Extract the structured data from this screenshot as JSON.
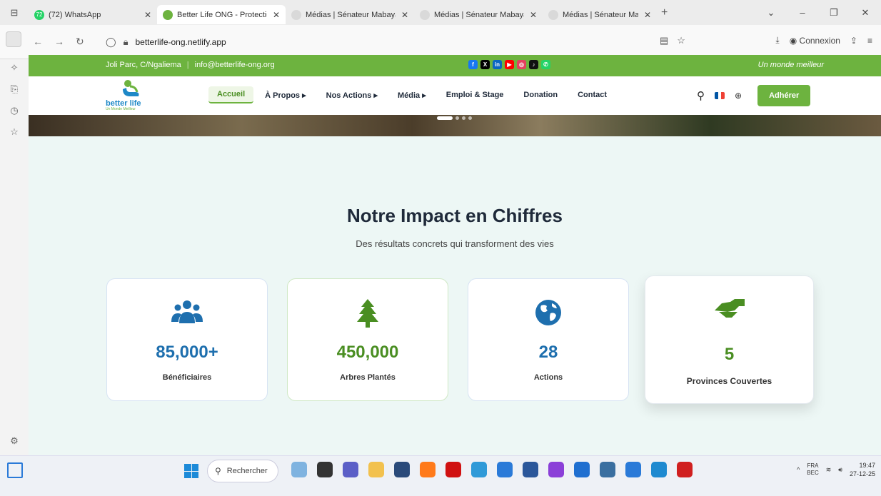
{
  "browser": {
    "tabs": [
      {
        "title": "(72) WhatsApp",
        "badge": "72",
        "color": "#25d366",
        "active": false
      },
      {
        "title": "Better Life ONG - Protection de",
        "color": "#6db33f",
        "active": true
      },
      {
        "title": "Médias | Sénateur Mabaya",
        "color": "#d9d9d9",
        "active": false
      },
      {
        "title": "Médias | Sénateur Mabaya",
        "color": "#d9d9d9",
        "active": false
      },
      {
        "title": "Médias | Sénateur Mabaya",
        "color": "#d9d9d9",
        "active": false
      }
    ],
    "url": "betterlife-ong.netlify.app",
    "signin_label": "Connexion"
  },
  "site": {
    "topbar": {
      "address": "Joli Parc, C/Ngaliema",
      "email": "info@betterlife-ong.org",
      "motto": "Un monde meilleur",
      "social_icons": [
        "facebook-icon",
        "x-icon",
        "linkedin-icon",
        "youtube-icon",
        "instagram-icon",
        "tiktok-icon",
        "whatsapp-icon"
      ]
    },
    "logo": {
      "name": "better life",
      "tagline": "Un Monde Meilleur"
    },
    "nav": {
      "items": [
        {
          "label": "Accueil",
          "active": true
        },
        {
          "label": "À Propos ▸"
        },
        {
          "label": "Nos Actions ▸"
        },
        {
          "label": "Média ▸"
        },
        {
          "label": "Emploi & Stage"
        },
        {
          "label": "Donation"
        },
        {
          "label": "Contact"
        }
      ],
      "cta": "Adhérer"
    },
    "impact": {
      "title": "Notre Impact en Chiffres",
      "subtitle": "Des résultats concrets qui transforment des vies",
      "stats": [
        {
          "value": "85,000+",
          "label": "Bénéficiaires",
          "icon": "users-icon",
          "color": "#1e6fae"
        },
        {
          "value": "450,000",
          "label": "Arbres Plantés",
          "icon": "tree-icon",
          "color": "#4a8e22"
        },
        {
          "value": "28",
          "label": "Actions",
          "icon": "globe-icon",
          "color": "#1e6fae"
        },
        {
          "value": "5",
          "label": "Provinces Couvertes",
          "icon": "handshake-icon",
          "color": "#4a8e22"
        }
      ]
    }
  },
  "taskbar": {
    "search_placeholder": "Rechercher",
    "lang": "FRA",
    "lang_sub": "BEC",
    "time": "19:47",
    "date": "27-12-25"
  }
}
